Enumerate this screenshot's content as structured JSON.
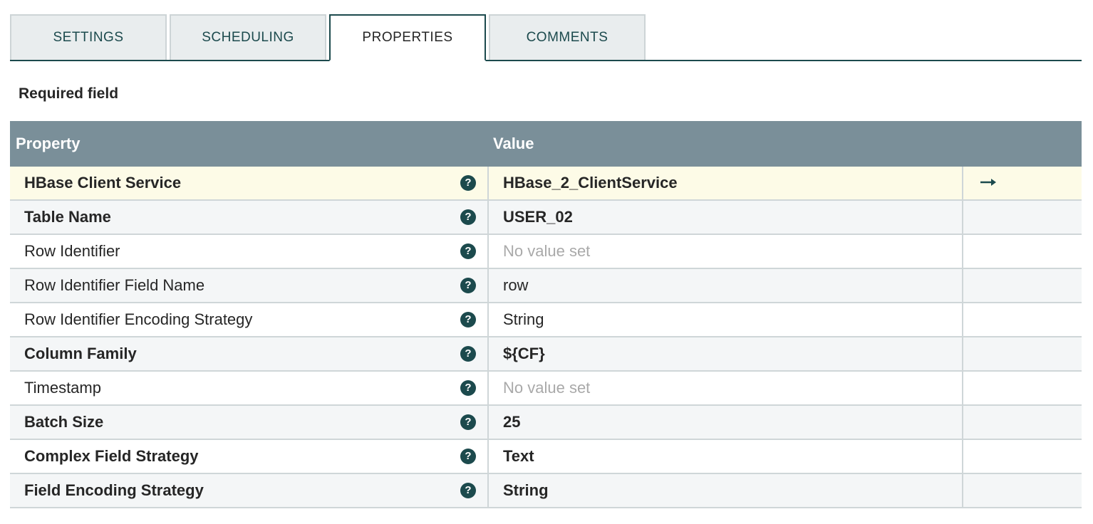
{
  "tabs": [
    {
      "label": "SETTINGS",
      "active": false
    },
    {
      "label": "SCHEDULING",
      "active": false
    },
    {
      "label": "PROPERTIES",
      "active": true
    },
    {
      "label": "COMMENTS",
      "active": false
    }
  ],
  "required_label": "Required field",
  "table": {
    "headers": {
      "property": "Property",
      "value": "Value"
    },
    "rows": [
      {
        "property": "HBase Client Service",
        "required": true,
        "value": "HBase_2_ClientService",
        "unset": false,
        "has_arrow": true
      },
      {
        "property": "Table Name",
        "required": true,
        "value": "USER_02",
        "unset": false,
        "has_arrow": false
      },
      {
        "property": "Row Identifier",
        "required": false,
        "value": "No value set",
        "unset": true,
        "has_arrow": false
      },
      {
        "property": "Row Identifier Field Name",
        "required": false,
        "value": "row",
        "unset": false,
        "has_arrow": false
      },
      {
        "property": "Row Identifier Encoding Strategy",
        "required": false,
        "value": "String",
        "unset": false,
        "has_arrow": false
      },
      {
        "property": "Column Family",
        "required": true,
        "value": "${CF}",
        "unset": false,
        "has_arrow": false
      },
      {
        "property": "Timestamp",
        "required": false,
        "value": "No value set",
        "unset": true,
        "has_arrow": false
      },
      {
        "property": "Batch Size",
        "required": true,
        "value": "25",
        "unset": false,
        "has_arrow": false
      },
      {
        "property": "Complex Field Strategy",
        "required": true,
        "value": "Text",
        "unset": false,
        "has_arrow": false
      },
      {
        "property": "Field Encoding Strategy",
        "required": true,
        "value": "String",
        "unset": false,
        "has_arrow": false
      }
    ]
  },
  "icons": {
    "help": "question-circle-icon",
    "goto": "arrow-right-icon"
  },
  "colors": {
    "accent": "#1c4a4d",
    "header_bg": "#7a8f99",
    "selected_row_bg": "#fdfbe7",
    "unset_text": "#a9a9a9"
  }
}
